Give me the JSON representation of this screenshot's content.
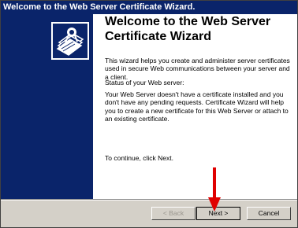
{
  "window": {
    "title": "Welcome to the Web Server Certificate Wizard."
  },
  "wizard": {
    "heading_line1": "Welcome to the Web Server",
    "heading_line2": "Certificate Wizard",
    "intro": "This wizard helps you create and administer server certificates used in secure Web communications between your server and a client.",
    "status_label": "Status of your Web server:",
    "status_text": "Your Web Server doesn't have a certificate installed and you don't have any pending requests. Certificate Wizard will help you to create a new certificate for this Web Server or attach to an existing certificate.",
    "continue_text": "To continue, click Next."
  },
  "buttons": {
    "back": "< Back",
    "next": "Next >",
    "cancel": "Cancel"
  },
  "colors": {
    "banner": "#0a246a",
    "arrow": "#e00000"
  }
}
